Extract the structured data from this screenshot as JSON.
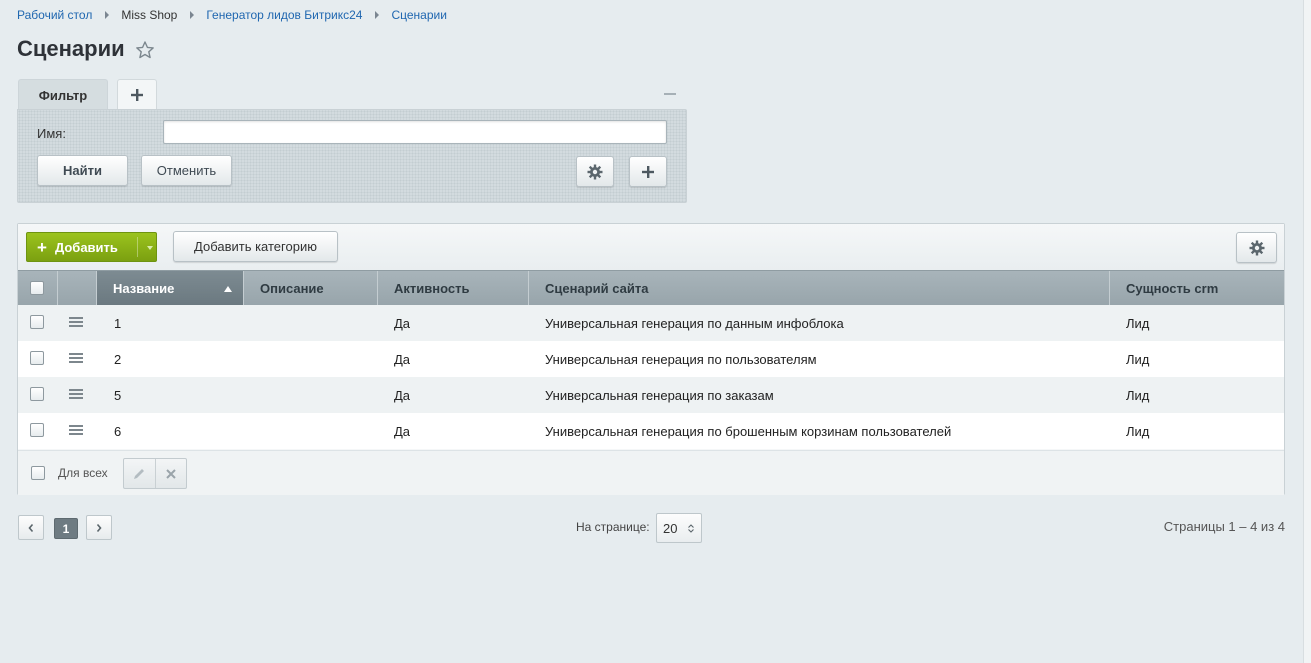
{
  "breadcrumb": {
    "items": [
      {
        "label": "Рабочий стол"
      },
      {
        "label": "Miss Shop"
      },
      {
        "label": "Генератор лидов Битрикс24"
      },
      {
        "label": "Сценарии"
      }
    ]
  },
  "page": {
    "title": "Сценарии"
  },
  "filter": {
    "tab_label": "Фильтр",
    "add_tab_icon": "plus-icon",
    "name_label": "Имя:",
    "name_value": "",
    "find_label": "Найти",
    "cancel_label": "Отменить"
  },
  "toolbar": {
    "add_label": "Добавить",
    "add_category_label": "Добавить категорию"
  },
  "table": {
    "columns": [
      "Название",
      "Описание",
      "Активность",
      "Сценарий сайта",
      "Сущность crm"
    ],
    "sorted_column": "Название",
    "rows": [
      {
        "name": "1",
        "description": "",
        "active": "Да",
        "scenario": "Универсальная генерация по данным инфоблока",
        "entity": "Лид"
      },
      {
        "name": "2",
        "description": "",
        "active": "Да",
        "scenario": "Универсальная генерация по пользователям",
        "entity": "Лид"
      },
      {
        "name": "5",
        "description": "",
        "active": "Да",
        "scenario": "Универсальная генерация по заказам",
        "entity": "Лид"
      },
      {
        "name": "6",
        "description": "",
        "active": "Да",
        "scenario": "Универсальная генерация по брошенным корзинам пользователей",
        "entity": "Лид"
      }
    ],
    "for_all_label": "Для всех"
  },
  "pagination": {
    "current_page": "1",
    "per_page_label": "На странице:",
    "per_page_value": "20",
    "pages_info": "Страницы 1 – 4 из 4"
  },
  "colors": {
    "accent_green": "#8bb418",
    "link_blue": "#2067b0",
    "header_gray": "#a1aeb4",
    "background": "#e6ecef"
  }
}
